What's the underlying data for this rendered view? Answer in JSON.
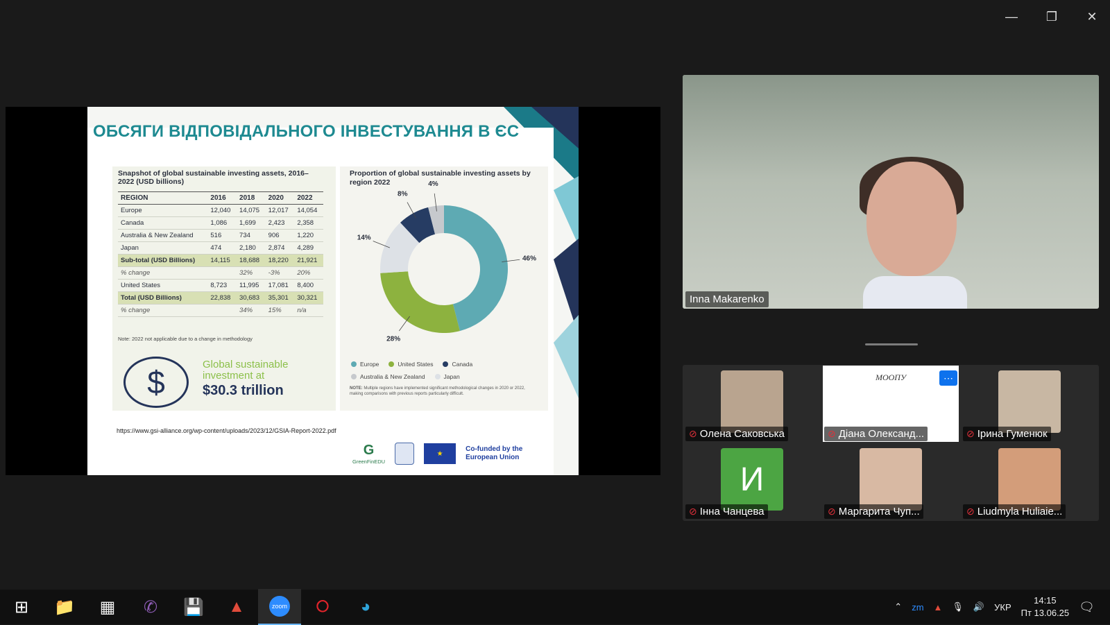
{
  "window": {
    "minimize_icon": "minimize-icon",
    "restore_icon": "restore-icon",
    "close_icon": "close-icon"
  },
  "slide": {
    "title": "ОБСЯГИ ВІДПОВІДАЛЬНОГО ІНВЕСТУВАННЯ В ЄС",
    "table_title": "Snapshot of global sustainable investing assets, 2016– 2022 (USD billions)",
    "table": {
      "headers": [
        "REGION",
        "2016",
        "2018",
        "2020",
        "2022"
      ],
      "rows": [
        {
          "region": "Europe",
          "v": [
            "12,040",
            "14,075",
            "12,017",
            "14,054"
          ],
          "kind": "normal"
        },
        {
          "region": "Canada",
          "v": [
            "1,086",
            "1,699",
            "2,423",
            "2,358"
          ],
          "kind": "normal"
        },
        {
          "region": "Australia & New Zealand",
          "v": [
            "516",
            "734",
            "906",
            "1,220"
          ],
          "kind": "normal"
        },
        {
          "region": "Japan",
          "v": [
            "474",
            "2,180",
            "2,874",
            "4,289"
          ],
          "kind": "normal"
        },
        {
          "region": "Sub-total (USD Billions)",
          "v": [
            "14,115",
            "18,688",
            "18,220",
            "21,921"
          ],
          "kind": "subtotal"
        },
        {
          "region": "% change",
          "v": [
            "",
            "32%",
            "-3%",
            "20%"
          ],
          "kind": "pct"
        },
        {
          "region": "United States",
          "v": [
            "8,723",
            "11,995",
            "17,081",
            "8,400"
          ],
          "kind": "normal"
        },
        {
          "region": "Total (USD Billions)",
          "v": [
            "22,838",
            "30,683",
            "35,301",
            "30,321"
          ],
          "kind": "subtotal"
        },
        {
          "region": "% change",
          "v": [
            "",
            "34%",
            "15%",
            "n/a"
          ],
          "kind": "pct"
        }
      ]
    },
    "table_note": "Note: 2022 not applicable due to a change in methodology",
    "invest_text": "Global sustainable investment at",
    "invest_amount": "$30.3 trillion",
    "pie_title": "Proportion of global sustainable investing assets by region 2022",
    "legend": [
      "Europe",
      "United States",
      "Canada",
      "Australia & New Zealand",
      "Japan"
    ],
    "pie_note_bold": "NOTE:",
    "pie_note": "Multiple regions have implemented significant methodological changes in 2020 or 2022, making comparisons with previous reports particularly difficult.",
    "url": "https://www.gsi-alliance.org/wp-content/uploads/2023/12/GSIA-Report-2022.pdf",
    "logo1": "GreenFinEDU",
    "eu_text": "Co-funded by the European Union"
  },
  "chart_data": {
    "type": "pie",
    "title": "Proportion of global sustainable investing assets by region 2022",
    "categories": [
      "Europe",
      "United States",
      "Australia & New Zealand",
      "Canada",
      "Japan"
    ],
    "values": [
      46,
      28,
      14,
      8,
      4
    ],
    "labels": [
      "46%",
      "28%",
      "14%",
      "8%",
      "4%"
    ],
    "colors": [
      "#5eaab3",
      "#8db23f",
      "#dde1e6",
      "#263c63",
      "#c6c9cd"
    ],
    "donut": true
  },
  "speaker": {
    "name": "Inna Makarenko"
  },
  "participants": [
    {
      "name": "Олена Саковська",
      "thumb": "photo",
      "color": "#b9a48f"
    },
    {
      "name": "Діана Олександ...",
      "thumb": "МООПУ",
      "color": "#ffffff"
    },
    {
      "name": "Ірина Гуменюк",
      "thumb": "photo",
      "color": "#c8b7a3"
    },
    {
      "name": "Інна Чанцева",
      "thumb": "И",
      "color": "#4ca543"
    },
    {
      "name": "Маргарита Чуп...",
      "thumb": "photo",
      "color": "#d8b9a3"
    },
    {
      "name": "Liudmyla Huliaie...",
      "thumb": "photo",
      "color": "#d39d7a"
    }
  ],
  "taskbar": {
    "icons": [
      "windows-start-icon",
      "file-explorer-icon",
      "calculator-icon",
      "viber-icon",
      "save-disk-icon",
      "media-app-icon",
      "zoom-icon",
      "opera-icon",
      "edge-icon"
    ],
    "lang": "УКР",
    "time": "14:15",
    "date": "Пт 13.06.25"
  }
}
